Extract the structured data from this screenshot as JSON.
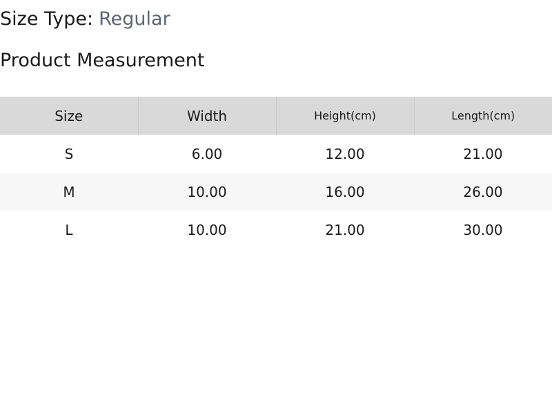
{
  "size_type": {
    "label": "Size Type:",
    "value": "Regular"
  },
  "section_title": "Product Measurement",
  "table": {
    "headers": [
      "Size",
      "Width",
      "Height(cm)",
      "Length(cm)"
    ],
    "rows": [
      [
        "S",
        "6.00",
        "12.00",
        "21.00"
      ],
      [
        "M",
        "10.00",
        "16.00",
        "26.00"
      ],
      [
        "L",
        "10.00",
        "21.00",
        "30.00"
      ]
    ]
  },
  "colors": {
    "header_bg": "#d9d9d9",
    "striped_row_bg": "#f7f7f7",
    "muted_value": "#5f6470"
  }
}
